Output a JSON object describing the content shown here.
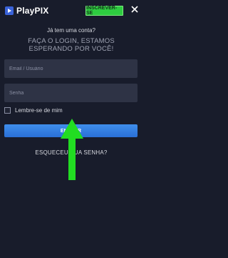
{
  "header": {
    "brand": "PlayPIX",
    "signup_label": "INSCREVER-SE"
  },
  "login": {
    "question": "Já tem uma conta?",
    "headline_line1": "FAÇA O LOGIN, ESTAMOS",
    "headline_line2": "ESPERANDO POR VOCÊ!",
    "email_placeholder": "Email / Usuário",
    "password_placeholder": "Senha",
    "remember_label": "Lembre-se de mim",
    "submit_label": "ENTRAR",
    "forgot_label": "ESQUECEU SUA SENHA?"
  },
  "colors": {
    "background": "#181c2b",
    "field": "#2e3345",
    "signup_green": "#2ecc40",
    "login_blue": "#2f7be0",
    "arrow_green": "#22dd22"
  },
  "icons": {
    "logo": "play-logo-icon",
    "close": "close-icon",
    "pointer": "up-arrow-icon"
  }
}
